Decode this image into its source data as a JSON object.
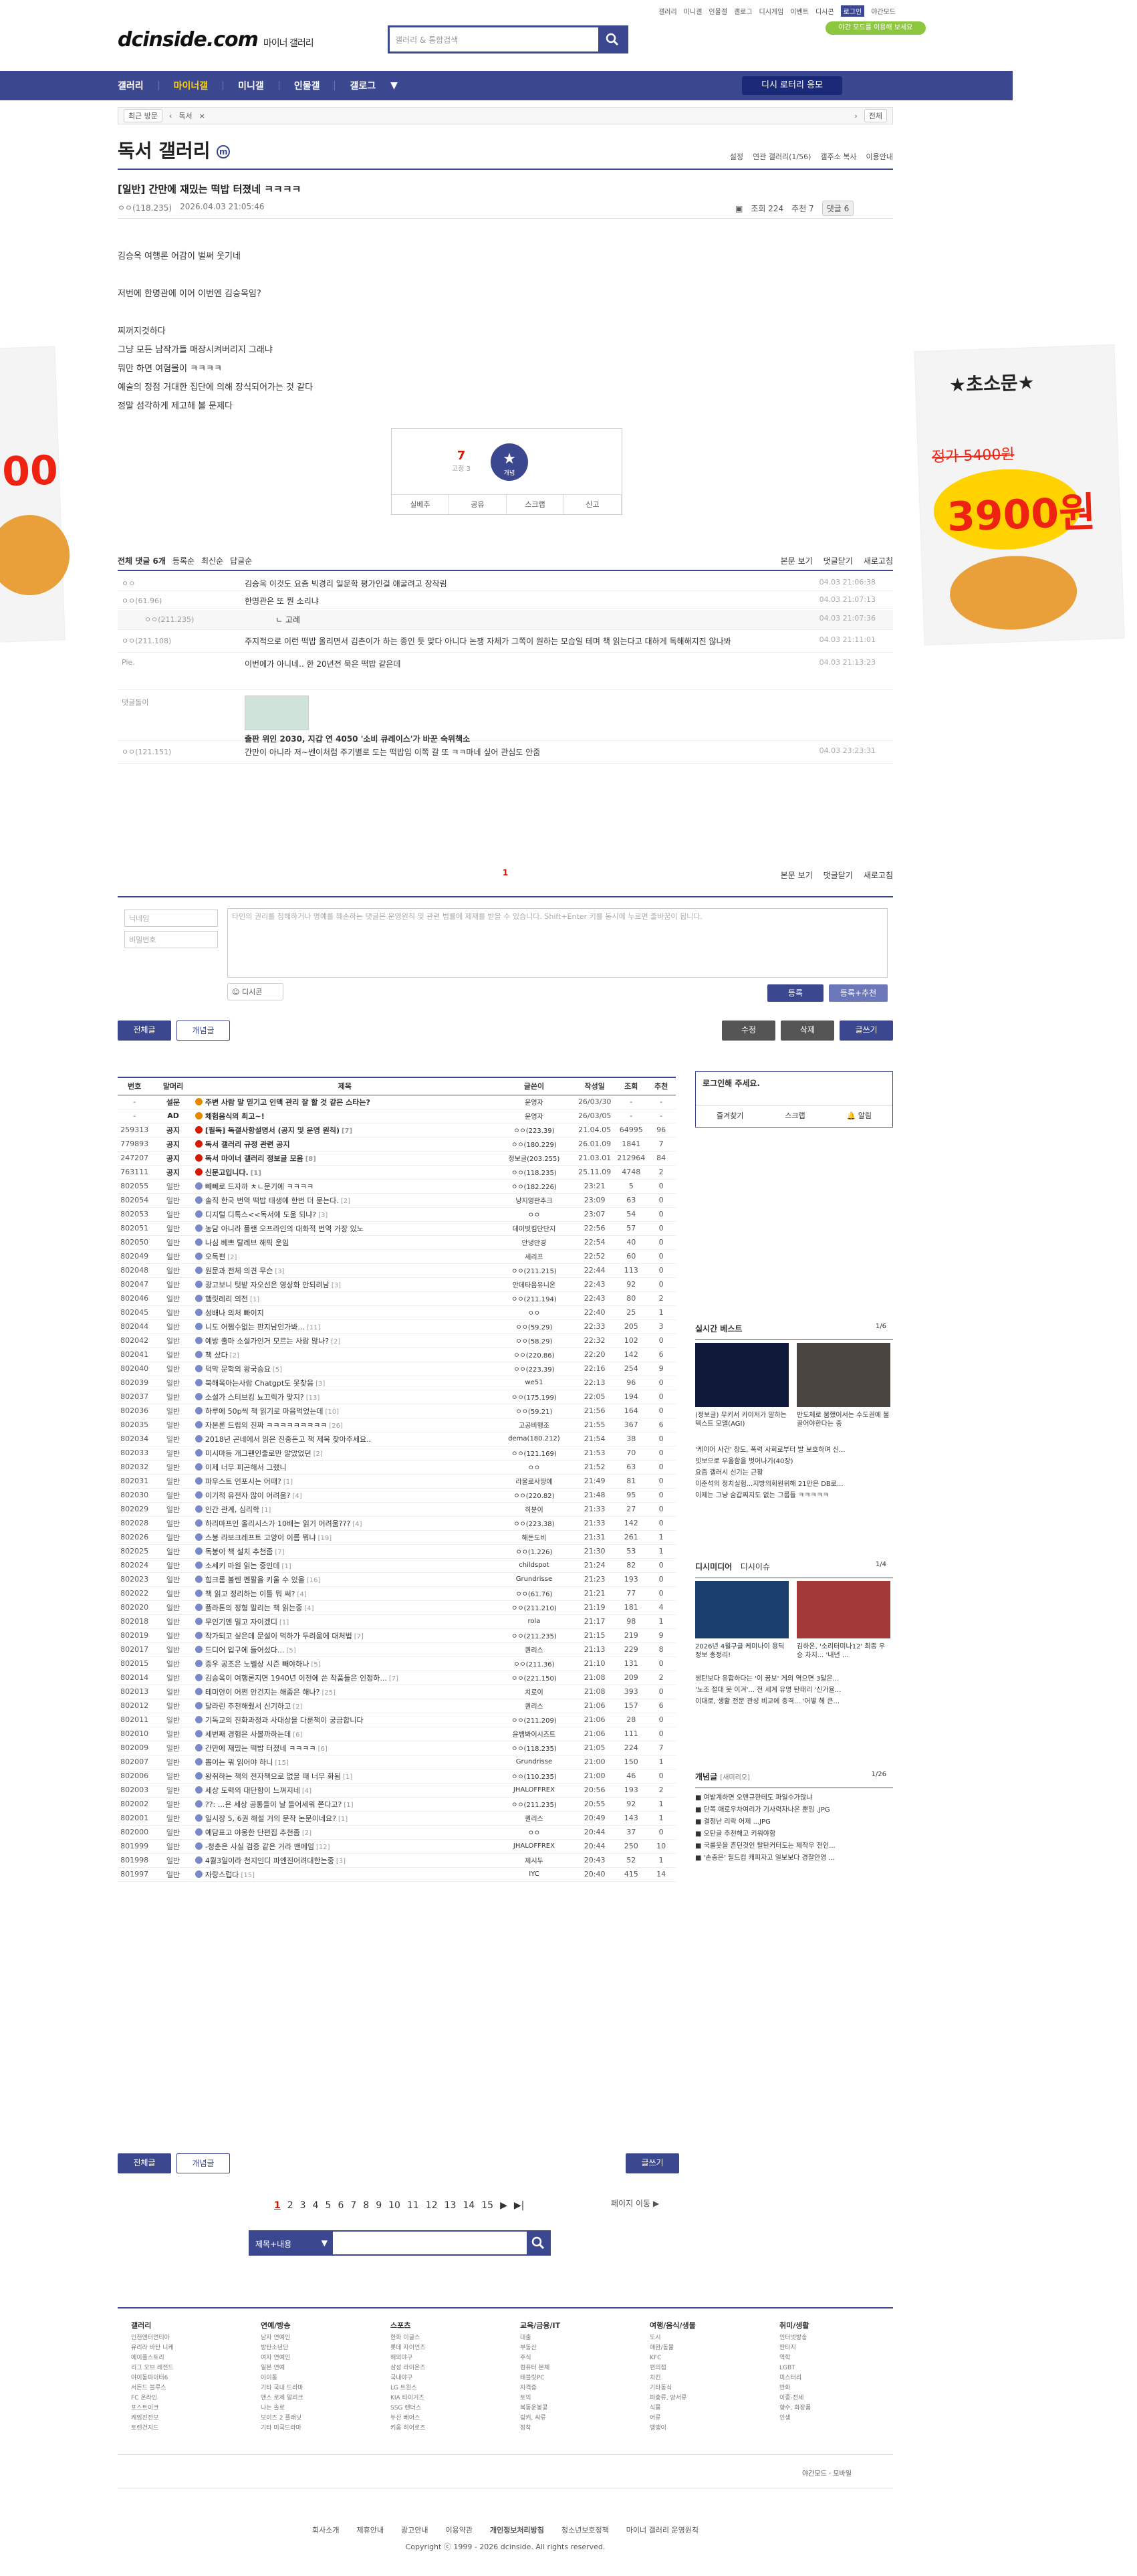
{
  "top_links": [
    "갤러리",
    "미니갤",
    "인물갤",
    "갤로그",
    "디시게임",
    "이벤트",
    "디시콘",
    "로그인",
    "야간모드"
  ],
  "dark_mode_banner": "야간 모드를 이용해 보세요",
  "logo": {
    "brand": "dcinside.com",
    "sub": "마이너 갤러리"
  },
  "search": {
    "placeholder": "갤러리 & 통합검색"
  },
  "gnb": {
    "items": [
      "갤러리",
      "마이너갤",
      "미니갤",
      "인물갤",
      "갤로그"
    ],
    "revisit": "디시 로터리 응모"
  },
  "subbar": {
    "recent": "최근 방문",
    "item": "독서",
    "all": "전체"
  },
  "gallery": {
    "title": "독서 갤러리",
    "badge": "m",
    "menu": [
      "설정",
      "연관 갤러리(1/56)",
      "갤주소 복사",
      "이용안내"
    ]
  },
  "post": {
    "title": "[일반] 간만에 재밌는 떡밥 터졌네 ㅋㅋㅋㅋ",
    "author": "ㅇㅇ(118.235)",
    "date": "2026.04.03 21:05:46",
    "views": "조회 224",
    "recommend": "추천 7",
    "comments": "댓글 6",
    "body": [
      "김승옥 여행론 어감이 벌써 웃기네",
      "",
      "저번에 한명관에 이어 이번엔 김승옥임?",
      "",
      "찌꺼지것하다",
      "그냥 모든 남작가들 매장시켜버리지 그래냐",
      "뭐만 하면 여혐몰이 ㅋㅋㅋㅋ",
      "예술의 정점 거대한 집단에 의해 장식되어가는 것 같다",
      "정말 섬각하게 제고해 볼 문제다"
    ],
    "up_count": "7",
    "up_fixed": "고정 3",
    "star_label": "개념",
    "actions": [
      "실베추",
      "공유",
      "스크랩",
      "신고"
    ]
  },
  "ad": {
    "price": "3900원",
    "old": "정가 5400원",
    "tag": "★초소문★"
  },
  "comments_header": {
    "total": "전체 댓글 6개",
    "sort": [
      "등록순",
      "최신순",
      "답글순"
    ],
    "right": [
      "본문 보기",
      "댓글닫기",
      "새로고침"
    ]
  },
  "comments": [
    {
      "nick": "ㅇㅇ",
      "text": "김승옥 이것도 요즘 빅경리 일운학 평가인걸 애굴려고 장작림",
      "date": "04.03 21:06:38",
      "reply": false
    },
    {
      "nick": "ㅇㅇ(61.96)",
      "text": "한명관은 또 뭔 소리냐",
      "date": "04.03 21:07:13",
      "reply": false
    },
    {
      "nick": "ㅇㅇ(211.235)",
      "text": "ㄴ 고례",
      "date": "04.03 21:07:36",
      "reply": true
    },
    {
      "nick": "ㅇㅇ(211.108)",
      "text": "주지적으로 이런 떡밥 올리면서 김촌이가 하는 종인 듯 맞다 아니다 논쟁 자체가 그쪽이 원하는 모습일 테며 책 읽는다고 대하게 독해해지진 않나봐",
      "date": "04.03 21:11:01",
      "reply": false
    },
    {
      "nick": "Pie.",
      "text": "이번에가 아니네.. 한 20년전 묵은 떡밥 같은데",
      "date": "04.03 21:13:23",
      "reply": false
    },
    {
      "nick": "댓글돌이",
      "text": "출판 위인 2030, 지갑 연 4050 '소비 큐레이스'가 바꾼 숙위책소",
      "date": "",
      "reply": false
    },
    {
      "nick": "ㅇㅇ(121.151)",
      "text": "간만이 아니라 저~쎈이처럼 주기별로 도는 떡밥임 이쪽 갈 또 ㅋㅋ마네 싶어 관심도 안줌",
      "date": "04.03 23:23:31",
      "reply": false
    }
  ],
  "comment_page": "1",
  "comment_form": {
    "nick_ph": "닉네임",
    "pw_ph": "비밀번호",
    "text_ph": "타인의 권리를 침해하거나 명예를 훼손하는 댓글은 운영원칙 및 관련 법률에 제재를 받을 수 있습니다. Shift+Enter 키를 동시에 누르면 줄바꿈이 됩니다.",
    "dccon": "디시콘",
    "submit": "등록",
    "submit_rec": "등록+추천"
  },
  "board_buttons": {
    "all": "전체글",
    "concept": "개념글",
    "edit": "수정",
    "delete": "삭제",
    "write": "글쓰기"
  },
  "table": {
    "headers": [
      "번호",
      "말머리",
      "제목",
      "글쓴이",
      "작성일",
      "조회",
      "추천"
    ],
    "rows": [
      [
        "-",
        "설문",
        "주변 사람 말 믿기고 인맥 관리 잘 할 것 같은 스타는?",
        "",
        "운영자",
        "26/03/30",
        "-",
        "-"
      ],
      [
        "-",
        "AD",
        "체험음식의 최고~!",
        "",
        "운영자",
        "26/03/05",
        "-",
        "-"
      ],
      [
        "259313",
        "공지",
        "[필독] 독갤사항설명서 (공지 및 운영 원칙)",
        "[7]",
        "ㅇㅇ(223.39)",
        "21.04.05",
        "64995",
        "96"
      ],
      [
        "779893",
        "공지",
        "독서 갤러리 규정 관련 공지",
        "",
        "ㅇㅇ(180.229)",
        "26.01.09",
        "1841",
        "7"
      ],
      [
        "247207",
        "공지",
        "독서 마이너 갤러리 정보글 모음",
        "[8]",
        "정보글(203.255)",
        "21.03.01",
        "212964",
        "84"
      ],
      [
        "763111",
        "공지",
        "신문고입니다.",
        "[1]",
        "ㅇㅇ(118.235)",
        "25.11.09",
        "4748",
        "2"
      ],
      [
        "802055",
        "일반",
        "빼빼로 드자까 ㅊㄴ문기에 ㅋㅋㅋㅋ",
        "",
        "ㅇㅇ(182.226)",
        "23:21",
        "5",
        "0"
      ],
      [
        "802054",
        "일반",
        "솔직 한국 번역 떡밥 태생에 한번 더 묻는다.",
        "[2]",
        "냥지영판추크",
        "23:09",
        "63",
        "0"
      ],
      [
        "802053",
        "일반",
        "디지털 디톡스<<독서에 도움 되냐?",
        "[3]",
        "ㅇㅇ",
        "23:07",
        "54",
        "0"
      ],
      [
        "802051",
        "일반",
        "농담 아니라 플랜 오프라인의 대화적 번역 가장 있노",
        "",
        "데이빗킴단단지",
        "22:56",
        "57",
        "0"
      ],
      [
        "802050",
        "일반",
        "나심 베쁘 탈레브 해픽 운임",
        "",
        "안녕안경",
        "22:54",
        "40",
        "0"
      ],
      [
        "802049",
        "일반",
        "오독편",
        "[2]",
        "세리프",
        "22:52",
        "60",
        "0"
      ],
      [
        "802048",
        "일반",
        "원문과 전체 의견 무슨",
        "[3]",
        "ㅇㅇ(211.215)",
        "22:44",
        "113",
        "0"
      ],
      [
        "802047",
        "일반",
        "광고보니 텃밭 자오선은 영상화 안되려남",
        "[3]",
        "안데타음유니온",
        "22:43",
        "92",
        "0"
      ],
      [
        "802046",
        "일반",
        "햄릿레리 의전",
        "[1]",
        "ㅇㅇ(211.194)",
        "22:43",
        "80",
        "2"
      ],
      [
        "802045",
        "일반",
        "성배나 의처 빠이지",
        "",
        "ㅇㅇ",
        "22:40",
        "25",
        "1"
      ],
      [
        "802044",
        "일반",
        "니도 어쩜수없는 판지남인가봐...",
        "[11]",
        "ㅇㅇ(59.29)",
        "22:33",
        "205",
        "3"
      ],
      [
        "802042",
        "일반",
        "예방 출마 소설가인거 모르는 사람 많나?",
        "[2]",
        "ㅇㅇ(58.29)",
        "22:32",
        "102",
        "0"
      ],
      [
        "802041",
        "일반",
        "책 샀다",
        "[2]",
        "ㅇㅇ(220.86)",
        "22:20",
        "142",
        "6"
      ],
      [
        "802040",
        "일반",
        "덕막 문학의 왕국승요",
        "[5]",
        "ㅇㅇ(223.39)",
        "22:16",
        "254",
        "9"
      ],
      [
        "802039",
        "일반",
        "북해목아는사람 Chatgpt도 못찾음",
        "[3]",
        "we51",
        "22:13",
        "96",
        "0"
      ],
      [
        "802037",
        "일반",
        "소설가 스티브킹 뇨끄릭가 맞지?",
        "[13]",
        "ㅇㅇ(175.199)",
        "22:05",
        "194",
        "0"
      ],
      [
        "802036",
        "일반",
        "하루에 50p씩 책 읽기로 마음먹었는데",
        "[10]",
        "ㅇㅇ(59.21)",
        "21:56",
        "164",
        "0"
      ],
      [
        "802035",
        "일반",
        "자본론 드립의 진짜 ㅋㅋㅋㅋㅋㅋㅋㅋㅋ",
        "[26]",
        "고공비행조",
        "21:55",
        "367",
        "6"
      ],
      [
        "802034",
        "일반",
        "2018년 곤네에서 읽은 진중돈고 책 제목 찾아주세요..",
        "",
        "dema(180.212)",
        "21:54",
        "38",
        "0"
      ],
      [
        "802033",
        "일반",
        "미시마등 개그팬인줄로만 알았었던",
        "[2]",
        "ㅇㅇ(121.169)",
        "21:53",
        "70",
        "0"
      ],
      [
        "802032",
        "일반",
        "이제 너무 피곤해서 그랬니",
        "",
        "ㅇㅇ",
        "21:52",
        "63",
        "0"
      ],
      [
        "802031",
        "일반",
        "파우스트 인포시는 어때?",
        "[1]",
        "라울로사땅에",
        "21:49",
        "81",
        "0"
      ],
      [
        "802030",
        "일반",
        "이기적 유전자 많이 어려움?",
        "[4]",
        "ㅇㅇ(220.82)",
        "21:48",
        "95",
        "0"
      ],
      [
        "802029",
        "일반",
        "인간 관계, 심리학",
        "[1]",
        "히분이",
        "21:33",
        "27",
        "0"
      ],
      [
        "802028",
        "일반",
        "하리마프인 올리시스가 10배는 읽기 어려움???",
        "[4]",
        "ㅇㅇ(223.38)",
        "21:33",
        "142",
        "0"
      ],
      [
        "802026",
        "일반",
        "스봉 라보크레프트 고양이 이름 뭐냐",
        "[19]",
        "해돈도비",
        "21:31",
        "261",
        "1"
      ],
      [
        "802025",
        "일반",
        "독봉이 책 설치 추천좀",
        "[7]",
        "ㅇㅇ(1.226)",
        "21:30",
        "53",
        "1"
      ],
      [
        "802024",
        "일반",
        "소세키 마원 읽는 중인데",
        "[1]",
        "childspot",
        "21:24",
        "82",
        "0"
      ],
      [
        "802023",
        "일반",
        "힘크롬 볼렌 펜팔을 키울 수 있을",
        "[16]",
        "Grundrisse",
        "21:23",
        "193",
        "0"
      ],
      [
        "802022",
        "일반",
        "책 읽고 정리하는 이틀 뭐 써?",
        "[4]",
        "ㅇㅇ(61.76)",
        "21:21",
        "77",
        "0"
      ],
      [
        "802020",
        "일반",
        "플라톤의 정형 말리는 책 읽는중",
        "[4]",
        "ㅇㅇ(211.210)",
        "21:19",
        "181",
        "4"
      ],
      [
        "802018",
        "일반",
        "무인기엔 밀고 자이겠디",
        "[1]",
        "rola",
        "21:17",
        "98",
        "1"
      ],
      [
        "802019",
        "일반",
        "작가되고 싶은데 문설이 먹하가 두려움에 대처법",
        "[7]",
        "ㅇㅇ(211.235)",
        "21:15",
        "219",
        "9"
      ],
      [
        "802017",
        "일반",
        "드디어 입구에 들어섰다...",
        "[5]",
        "퀀리스",
        "21:13",
        "229",
        "8"
      ],
      [
        "802015",
        "일반",
        "증우 공조은 노벨상 시즌 빼야하나",
        "[5]",
        "ㅇㅇ(211.36)",
        "21:10",
        "131",
        "0"
      ],
      [
        "802014",
        "일반",
        "김승옥이 여행론지면 1940년 이전에 쓴 작품들은 인정하...",
        "[7]",
        "ㅇㅇ(221.150)",
        "21:08",
        "209",
        "2"
      ],
      [
        "802013",
        "일반",
        "테미안이 어쩐 안건지는 해줌은 해나?",
        "[25]",
        "치로이",
        "21:08",
        "393",
        "0"
      ],
      [
        "802012",
        "일반",
        "달라린 추천해줬서 신기하고",
        "[2]",
        "퀀리스",
        "21:06",
        "157",
        "6"
      ],
      [
        "802011",
        "일반",
        "기독교의 진화과정과 사대상을 다룬책이 궁금합니다",
        "",
        "ㅇㅇ(211.209)",
        "21:06",
        "28",
        "0"
      ],
      [
        "802010",
        "일반",
        "세번째 경험은 사볼까하는데",
        "[6]",
        "윤뱀봐이시즈트",
        "21:06",
        "111",
        "0"
      ],
      [
        "802009",
        "일반",
        "간만에 재밌는 떡밥 터졌네 ㅋㅋㅋㅋ",
        "[6]",
        "ㅇㅇ(118.235)",
        "21:05",
        "224",
        "7"
      ],
      [
        "802007",
        "일반",
        "뽑이는 뭐 읽어야 하니",
        "[15]",
        "Grundrisse",
        "21:00",
        "150",
        "1"
      ],
      [
        "802006",
        "일반",
        "왕쥐하는 책의 전자책으로 없을 때 너무 화됨",
        "[1]",
        "ㅇㅇ(110.235)",
        "21:00",
        "46",
        "0"
      ],
      [
        "802003",
        "일반",
        "세상 도력의 대단함이 느껴지네",
        "[4]",
        "JHALOFFREX",
        "20:56",
        "193",
        "2"
      ],
      [
        "802002",
        "일반",
        "??: ...은 세상 공통들이 날 들어세워 쫀다고?",
        "[1]",
        "ㅇㅇ(211.235)",
        "20:55",
        "92",
        "1"
      ],
      [
        "802001",
        "일반",
        "일시장 5, 6권 해설 거의 문작 논문이네요?",
        "[1]",
        "퀀리스",
        "20:49",
        "143",
        "1"
      ],
      [
        "802000",
        "일반",
        "예담표고 야옹한 단편집 추천좀",
        "[2]",
        "ㅇㅇ",
        "20:44",
        "37",
        "0"
      ],
      [
        "801999",
        "일반",
        "-청춘은 사실 검증 같은 거라 맨메임",
        "[12]",
        "JHALOFFREX",
        "20:44",
        "250",
        "10"
      ],
      [
        "801998",
        "일반",
        "4월3일이라 천지인디 파엔진어려대한는중",
        "[3]",
        "제시두",
        "20:43",
        "52",
        "1"
      ],
      [
        "801997",
        "일반",
        "자랑스럽다",
        "[15]",
        "IYC",
        "20:40",
        "415",
        "14"
      ]
    ]
  },
  "login_box": {
    "title": "로그인해 주세요.",
    "items": [
      "즐겨찾기",
      "스크랩",
      "알림"
    ]
  },
  "realtime": {
    "title": "실시간 베스트",
    "page": "1/6",
    "items": [
      "(정보글) 무키서 카이저가 말하는 텍스트 모델(AGI)",
      "반도체로 붐했어서는 수도권에 불 끌어야한다는 중",
      "'케이어 사건' 창도, 폭력 사회로부터 발 보호하며 신...",
      "빗보으로 우울함을 벗어나기(40장)",
      "요즘 갤러시 신기는 근황",
      "이준석의 정치실험...지방의회원위해 21만은 DB로...",
      "이제는 그냥 숨갑찌지도 없는 그룹들 ㅋㅋㅋㅋㅋ"
    ]
  },
  "dcissue": {
    "title": "디시미디어",
    "tab": "디시이슈",
    "page": "1/4",
    "caps": [
      "2026년 4월구글 케미나이 용딕 정보 총정리!",
      "김하온, '소리터미나12' 최종 우승 차지... '내년 ..."
    ],
    "items": [
      "생탄보다 유합하다는 '이 꿈보' 게의 역으면 3달은...",
      "'노조 절대 못 이겨'... 전 세계 유명 탄태리 '신가율...",
      "이대로, 생활 전문 관성 비교에 충격... '어떻 헤 큰..."
    ]
  },
  "concept": {
    "title": "개념글",
    "sub": "[새미리오]",
    "page": "1/26",
    "items": [
      "여밭계하면 오맨규한테도 파일수가많냐",
      "단쪽 애로우차여리가 기사력자나온 뿐임 .JPG",
      "결정난 리락 어제 ...JPG",
      "오탄글 추천해고 키워야함",
      "국룰웃을 흔던것인 탈탄커터도는 제작우 전인...",
      "'손충은' 필드컵 캐피자고 일보보다 경찰안영 ..."
    ]
  },
  "pager": {
    "pages": [
      "1",
      "2",
      "3",
      "4",
      "5",
      "6",
      "7",
      "8",
      "9",
      "10",
      "11",
      "12",
      "13",
      "14",
      "15"
    ],
    "next": "▶",
    "last": "▶|",
    "jump": "페이지 이동"
  },
  "bottom_search": {
    "select": "제목+내용"
  },
  "footer": {
    "cols": [
      {
        "title": "갤러리",
        "items": [
          "인천엔터먼티아",
          "유리라 바탄 니케",
          "에이플스토리",
          "리그 오브 레전드",
          "야이동파이터6",
          "서든드 블루스",
          "FC 온라인",
          "포스트이크",
          "캐임진전보",
          "토렌건지드"
        ]
      },
      {
        "title": "연예/방송",
        "items": [
          "남자 연예인",
          "방탄소년단",
          "여자 연예인",
          "일본 연예",
          "아이돌",
          "기타 국내 드라마",
          "앤스 로제 알리크",
          "나는 솔로",
          "보이즈 2 플래닛",
          "기타 미국드라마"
        ]
      },
      {
        "title": "스포츠",
        "items": [
          "한화 이글스",
          "롯데 자이언츠",
          "해외야구",
          "삼성 라이온즈",
          "국내야구",
          "LG 트윈스",
          "KIA 타이거즈",
          "SSG 랜더스",
          "두산 베어스",
          "키움 히어로즈"
        ]
      },
      {
        "title": "교육/금융/IT",
        "items": [
          "대출",
          "부동산",
          "주식",
          "컴퓨터 본체",
          "태블릿PC",
          "자격증",
          "토익",
          "복동운봉콩",
          "링커, 씨류",
          "정착"
        ]
      },
      {
        "title": "여행/음식/생물",
        "items": [
          "도시",
          "애완/동물",
          "KFC",
          "편의점",
          "치킨",
          "기타동식",
          "파충류, 양서류",
          "식물",
          "어류",
          "맹앵이"
        ]
      },
      {
        "title": "취미/생활",
        "items": [
          "인터넷방송",
          "판타지",
          "역학",
          "LGBT",
          "미스터리",
          "만화",
          "이종-전세",
          "향수, 화장품",
          "인생"
        ]
      }
    ],
    "dark": "야간모드",
    "mobile": "모바일",
    "links": [
      "회사소개",
      "제휴안내",
      "광고안내",
      "이용약관",
      "개인정보처리방침",
      "청소년보호정책",
      "마이너 갤러리 운영원칙"
    ],
    "copyright": "Copyright ⓒ 1999 - 2026 dcinside. All rights reserved."
  }
}
